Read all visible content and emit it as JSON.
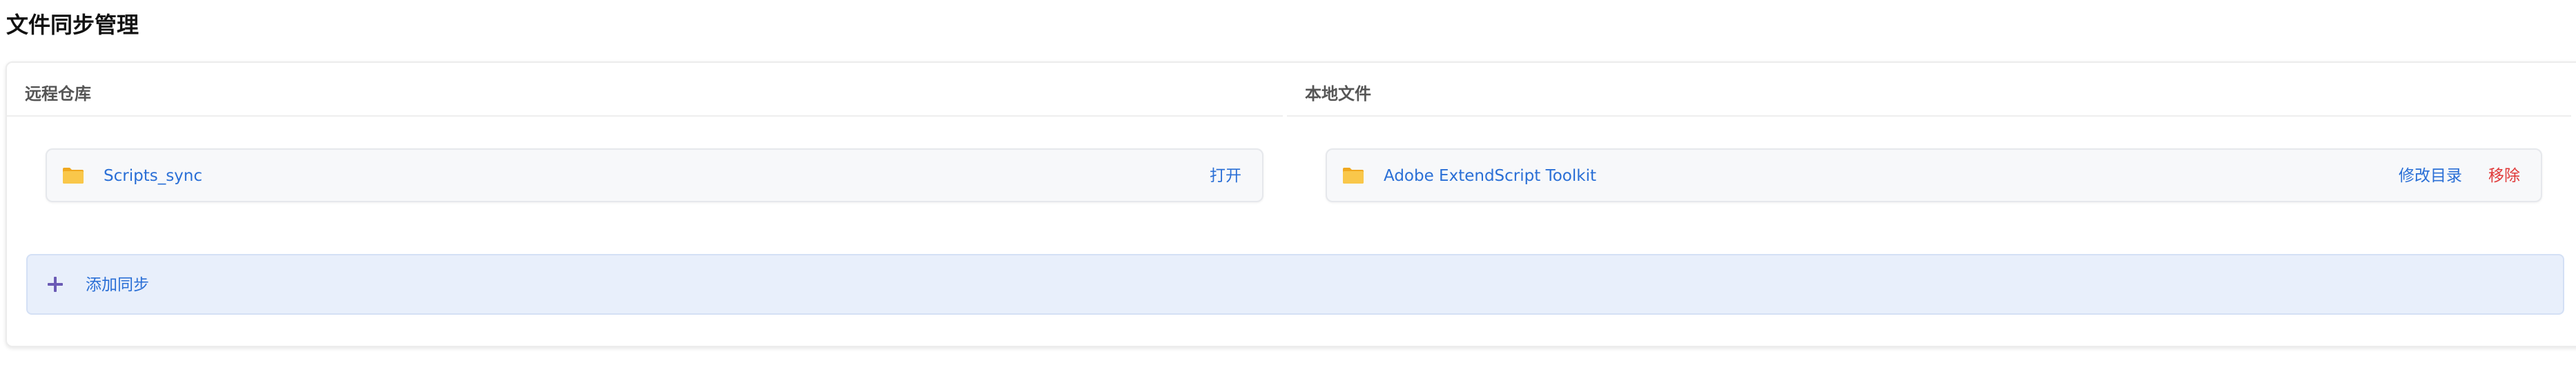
{
  "page": {
    "title": "文件同步管理"
  },
  "remote": {
    "header": "远程仓库",
    "item": {
      "name": "Scripts_sync",
      "icon": "folder-icon",
      "action_open": "打开"
    }
  },
  "local": {
    "header": "本地文件",
    "item": {
      "name": "Adobe ExtendScript Toolkit",
      "icon": "folder-icon",
      "action_modify": "修改目录",
      "action_remove": "移除"
    }
  },
  "add_sync": {
    "label": "添加同步",
    "icon": "plus-icon"
  },
  "colors": {
    "link": "#2a6fd6",
    "danger": "#e03a3a",
    "folder": "#f5b82e",
    "add_bg": "#e8effb",
    "plus": "#6b5bb5"
  }
}
